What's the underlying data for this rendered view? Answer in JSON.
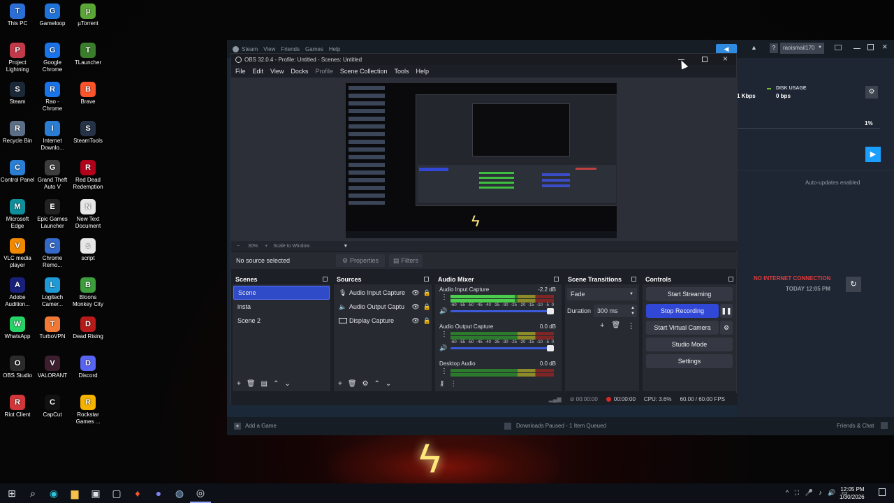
{
  "desktop_icons": [
    {
      "label": "This PC",
      "icon": "pc-icon",
      "color": "#2b6fd6"
    },
    {
      "label": "Gameloop",
      "icon": "gameloop-icon",
      "color": "#1e73d9"
    },
    {
      "label": "µTorrent",
      "icon": "utorrent-icon",
      "color": "#5aa637"
    },
    {
      "label": "Project Lightning",
      "icon": "lightning-icon",
      "color": "#c23a4a"
    },
    {
      "label": "Google Chrome",
      "icon": "chrome-icon",
      "color": "#1a73e8"
    },
    {
      "label": "TLauncher",
      "icon": "tlauncher-icon",
      "color": "#3a7d2c"
    },
    {
      "label": "Steam",
      "icon": "steam-icon",
      "color": "#1b2838"
    },
    {
      "label": "Rao - Chrome",
      "icon": "chrome-profile-icon",
      "color": "#1a73e8"
    },
    {
      "label": "Brave",
      "icon": "brave-icon",
      "color": "#fb542b"
    },
    {
      "label": "Recycle Bin",
      "icon": "recycle-bin-icon",
      "color": "#5c6f86"
    },
    {
      "label": "Internet Downlo...",
      "icon": "idm-icon",
      "color": "#2b7cd3"
    },
    {
      "label": "SteamTools",
      "icon": "steamtools-icon",
      "color": "#263246"
    },
    {
      "label": "Control Panel",
      "icon": "control-panel-icon",
      "color": "#2a7fd4"
    },
    {
      "label": "Grand Theft Auto V",
      "icon": "gta-icon",
      "color": "#3d3d3d"
    },
    {
      "label": "Red Dead Redemption",
      "icon": "rdr-icon",
      "color": "#b3001b"
    },
    {
      "label": "Microsoft Edge",
      "icon": "edge-icon",
      "color": "#0f8f9c"
    },
    {
      "label": "Epic Games Launcher",
      "icon": "epic-icon",
      "color": "#222222"
    },
    {
      "label": "New Text Document",
      "icon": "text-doc-icon",
      "color": "#e7e7e7"
    },
    {
      "label": "VLC media player",
      "icon": "vlc-icon",
      "color": "#f18a00"
    },
    {
      "label": "Chrome Remo...",
      "icon": "chrome-remote-icon",
      "color": "#3468c9"
    },
    {
      "label": "script",
      "icon": "script-icon",
      "color": "#e7e7e7"
    },
    {
      "label": "Adobe Audition...",
      "icon": "audition-icon",
      "color": "#18207a"
    },
    {
      "label": "Logitech Camer...",
      "icon": "logitech-icon",
      "color": "#1e9ad6"
    },
    {
      "label": "Bloons Monkey City",
      "icon": "bloons-icon",
      "color": "#3c9e3c"
    },
    {
      "label": "WhatsApp",
      "icon": "whatsapp-icon",
      "color": "#25d366"
    },
    {
      "label": "TurboVPN",
      "icon": "turbovpn-icon",
      "color": "#f27935"
    },
    {
      "label": "Dead Rising",
      "icon": "dead-rising-icon",
      "color": "#b81a1a"
    },
    {
      "label": "OBS Studio",
      "icon": "obs-icon",
      "color": "#2b2b2b"
    },
    {
      "label": "VALORANT",
      "icon": "valorant-icon",
      "color": "#3c1e2e"
    },
    {
      "label": "Discord",
      "icon": "discord-icon",
      "color": "#5865f2"
    },
    {
      "label": "Riot Client",
      "icon": "riot-icon",
      "color": "#d13639"
    },
    {
      "label": "CapCut",
      "icon": "capcut-icon",
      "color": "#111111"
    },
    {
      "label": "Rockstar Games ...",
      "icon": "rockstar-icon",
      "color": "#f5b300"
    }
  ],
  "steam": {
    "menu": [
      "Steam",
      "View",
      "Friends",
      "Games",
      "Help"
    ],
    "username": "raoismail170",
    "help": "?",
    "network_value": "1 Kbps",
    "disk_label": "DISK USAGE",
    "disk_value": "0 bps",
    "percent": "1%",
    "auto_updates": "Auto-updates enabled",
    "no_internet": "NO INTERNET CONNECTION",
    "today": "TODAY 12:05 PM",
    "add_game": "Add a Game",
    "downloads": "Downloads Paused - 1 Item Queued",
    "friends_chat": "Friends & Chat"
  },
  "obs": {
    "title": "OBS 32.0.4 - Profile: Untitled - Scenes: Untitled",
    "menu": [
      "File",
      "Edit",
      "View",
      "Docks",
      "Profile",
      "Scene Collection",
      "Tools",
      "Help"
    ],
    "zoom": "30%",
    "scale": "Scale to Window",
    "no_source": "No source selected",
    "properties": "Properties",
    "filters": "Filters",
    "scenes_title": "Scenes",
    "scenes": [
      "Scene",
      "insta",
      "Scene 2"
    ],
    "sources_title": "Sources",
    "sources": [
      "Audio Input Capture",
      "Audio Output Captu",
      "Display Capture"
    ],
    "mixer_title": "Audio Mixer",
    "channels": [
      {
        "name": "Audio Input Capture",
        "db": "-2.2 dB",
        "level": 0.62
      },
      {
        "name": "Audio Output Capture",
        "db": "0.0 dB",
        "level": 0.0
      },
      {
        "name": "Desktop Audio",
        "db": "0.0 dB",
        "level": 0.0
      }
    ],
    "meter_ticks": [
      "-60",
      "-55",
      "-50",
      "-45",
      "-40",
      "-35",
      "-30",
      "-25",
      "-20",
      "-15",
      "-10",
      "-5",
      "0"
    ],
    "transitions_title": "Scene Transitions",
    "transition": "Fade",
    "duration_label": "Duration",
    "duration": "300 ms",
    "controls_title": "Controls",
    "controls": [
      "Start Streaming",
      "Stop Recording",
      "Start Virtual Camera",
      "Studio Mode",
      "Settings"
    ],
    "status": {
      "stream_time": "00:00:00",
      "rec_time": "00:00:00",
      "cpu": "CPU: 3.6%",
      "fps": "60.00 / 60.00 FPS"
    }
  },
  "taskbar": {
    "time": "12:05 PM",
    "date": "1/30/2026"
  }
}
